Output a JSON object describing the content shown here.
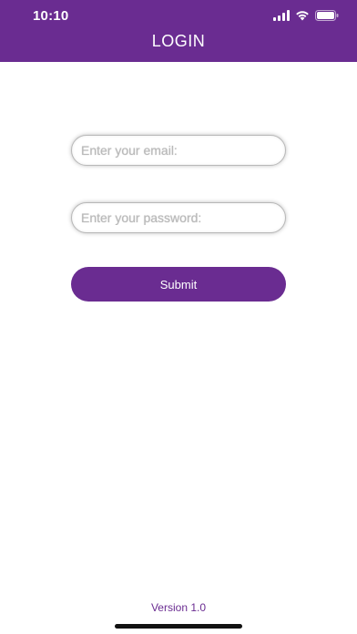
{
  "status_bar": {
    "time": "10:10",
    "icons": [
      "signal-icon",
      "wifi-icon",
      "battery-icon"
    ]
  },
  "header": {
    "title": "LOGIN"
  },
  "form": {
    "email_placeholder": "Enter your email:",
    "email_value": "",
    "password_placeholder": "Enter your password:",
    "password_value": "",
    "submit_label": "Submit"
  },
  "footer": {
    "version": "Version 1.0"
  },
  "colors": {
    "primary": "#6a2c91",
    "background": "#ffffff"
  }
}
